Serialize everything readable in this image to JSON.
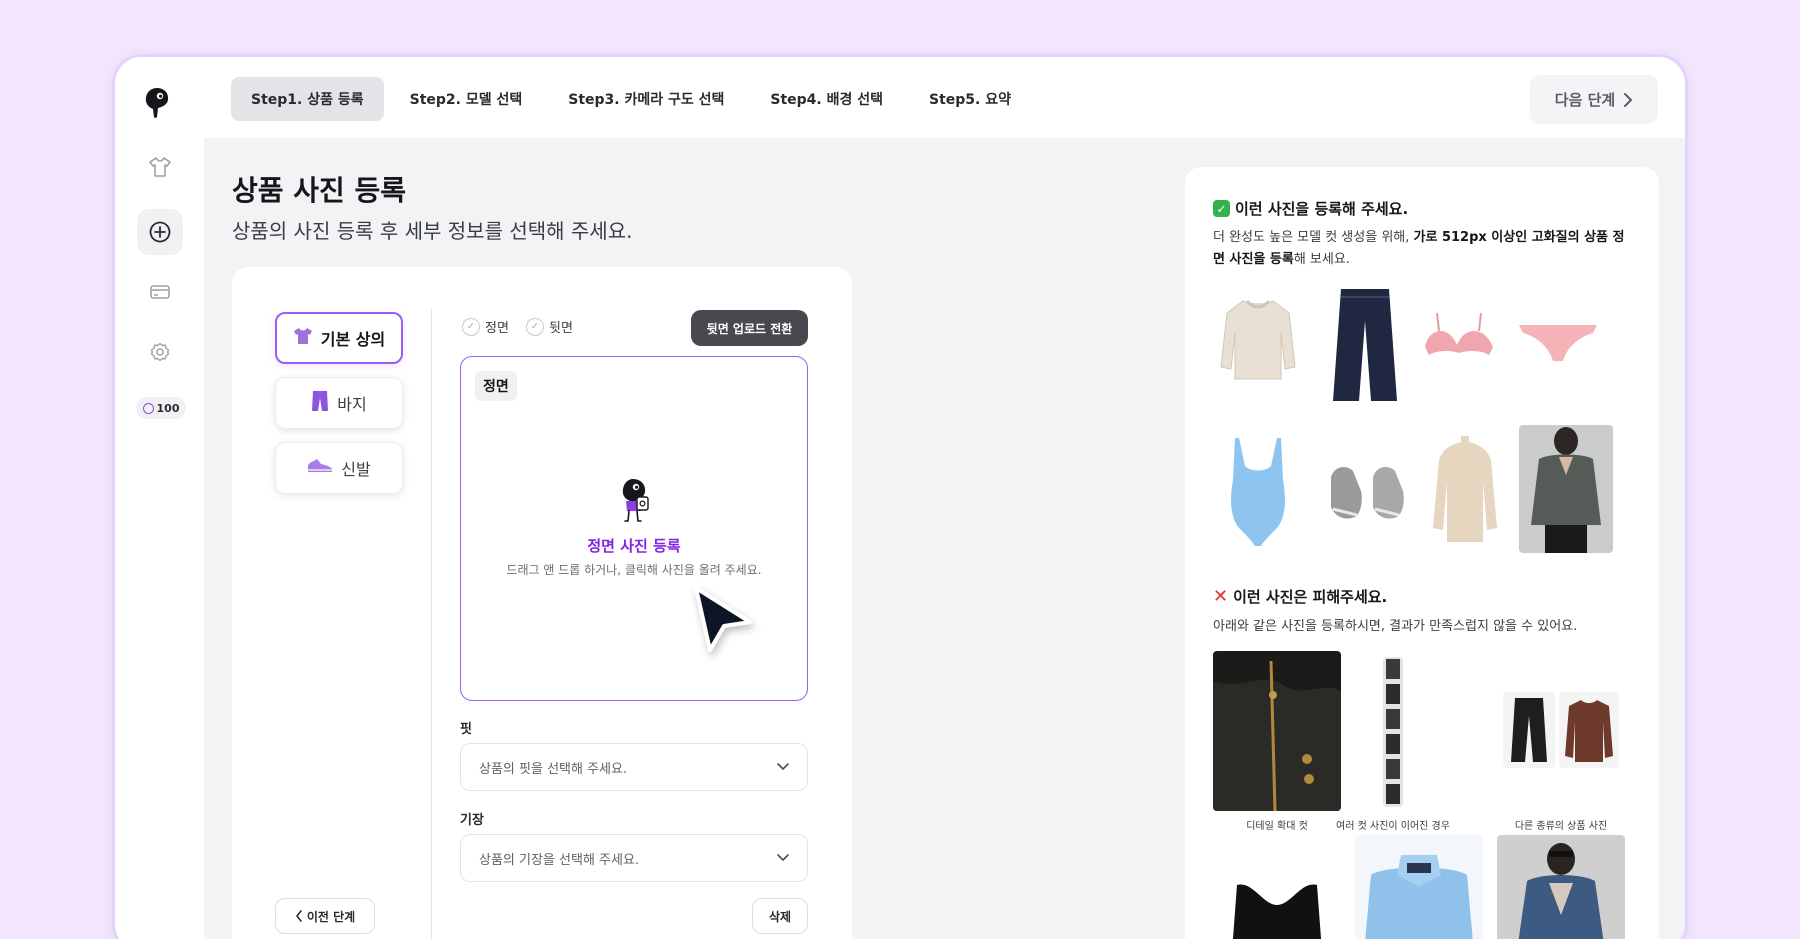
{
  "credits": "100",
  "steps": [
    {
      "label": "Step1. 상품 등록"
    },
    {
      "label": "Step2. 모델 선택"
    },
    {
      "label": "Step3. 카메라 구도 선택"
    },
    {
      "label": "Step4. 배경 선택"
    },
    {
      "label": "Step5. 요약"
    }
  ],
  "next_label": "다음 단계",
  "page": {
    "title": "상품 사진 등록",
    "subtitle": "상품의 사진 등록 후 세부 정보를 선택해 주세요."
  },
  "categories": [
    {
      "label": "기본 상의",
      "icon": "shirt-icon"
    },
    {
      "label": "바지",
      "icon": "pants-icon"
    },
    {
      "label": "신발",
      "icon": "shoe-icon"
    }
  ],
  "view_options": {
    "front": "정면",
    "back": "뒷면"
  },
  "switch_label": "뒷면 업로드 전환",
  "upload": {
    "tag": "정면",
    "title": "정면 사진 등록",
    "desc": "드래그 앤 드롭 하거나, 클릭해 사진을 올려 주세요."
  },
  "fit": {
    "label": "핏",
    "placeholder": "상품의 핏을 선택해 주세요."
  },
  "length": {
    "label": "기장",
    "placeholder": "상품의 기장을 선택해 주세요."
  },
  "prev_label": "이전 단계",
  "delete_label": "삭제",
  "guide": {
    "good_title": "이런 사진을 등록해 주세요.",
    "good_desc_pre": "더 완성도 높은 모델 컷 생성을 위해, ",
    "good_desc_bold": "가로 512px 이상인 고화질의 상품 정면 사진을 등록",
    "good_desc_post": "해 보세요.",
    "bad_title": "이런 사진은 피해주세요.",
    "bad_desc": "아래와 같은 사진을 등록하시면, 결과가 만족스럽지 않을 수 있어요.",
    "bad_captions": [
      "디테일 확대 컷",
      "여러 컷 사진이 이어진 경우",
      "다른 종류의 상품 사진"
    ]
  },
  "colors": {
    "accent": "#9b5ef2",
    "accent_text": "#8224e3",
    "background": "#f1e6fd"
  }
}
